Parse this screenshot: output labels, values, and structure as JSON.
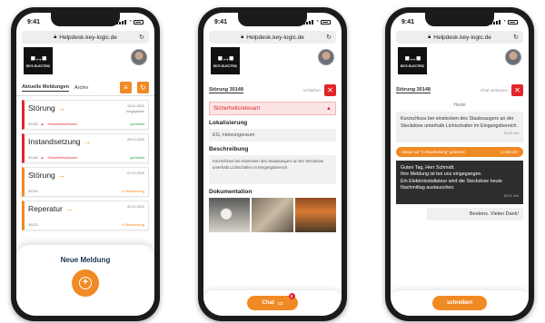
{
  "status": {
    "time": "9:41"
  },
  "browser": {
    "url": "Helpdesk.key-logic.de"
  },
  "brand": {
    "mark": "■↔■",
    "name": "ED'S ELECTRIC"
  },
  "list_screen": {
    "tabs": [
      "Aktuelle Meldungen",
      "Archiv"
    ],
    "cards": [
      {
        "title": "Störung",
        "date": "13.01.2020",
        "sub": "eingegeben",
        "id": "30145",
        "warning": "Sicherheitsrelevant",
        "state": "gemeldet",
        "accent": "#e0262c",
        "state_color": "#2e9b46"
      },
      {
        "title": "Instandsetzung",
        "date": "29.01.2020",
        "sub": "",
        "id": "30146",
        "warning": "Sicherheitsrelevant",
        "state": "gemeldet",
        "accent": "#e0262c",
        "state_color": "#2e9b46"
      },
      {
        "title": "Störung",
        "date": "07.01.2020",
        "sub": "",
        "id": "30134",
        "warning": "",
        "state": "in Bearbeitung",
        "accent": "#f08a24",
        "state_color": "#f08a24"
      },
      {
        "title": "Reperatur",
        "date": "20.01.2020",
        "sub": "",
        "id": "30123",
        "warning": "",
        "state": "in Bearbeitung",
        "accent": "#f08a24",
        "state_color": "#f08a24"
      }
    ],
    "new_label": "Neue Meldung"
  },
  "detail_screen": {
    "title": "Störung 30148",
    "close_label": "schließen",
    "alert": "Sicherheitsrelevant",
    "loc_label": "Lokalisierung",
    "loc_value": "EG, Heizungsraum",
    "desc_label": "Beschreibung",
    "desc_value": "Kurzschluss bei einstecken des Staubsaugers an der Steckdose unterhalb Lichtschalter im Eingangsbereich",
    "docs_label": "Dokumentation",
    "chat_label": "Chat",
    "chat_badge": "2"
  },
  "chat_screen": {
    "title": "Störung 30148",
    "close_label": "Chat verlassen",
    "day": "Heute",
    "msg1": "Kurzschluss bei einstecken des Staubsaugers an der Steckdose unterhalb Lichtschalter im Eingangsbereich.",
    "msg1_time": "13:20 Uhr",
    "sys": "Status auf \"In Bearbeitung\" geändert",
    "sys_time": "14:38 Uhr",
    "msg2": "Guten Tag, Herr Schmidt.\nIhre Meldung ist bei uns eingegangen.\nEin Elektroinstallateur wird die Steckdose heute Nachmittag austauschen.",
    "msg2_time": "15:01 Uhr",
    "msg3": "Bestens. Vielen Dank!",
    "send_label": "schreiben"
  }
}
